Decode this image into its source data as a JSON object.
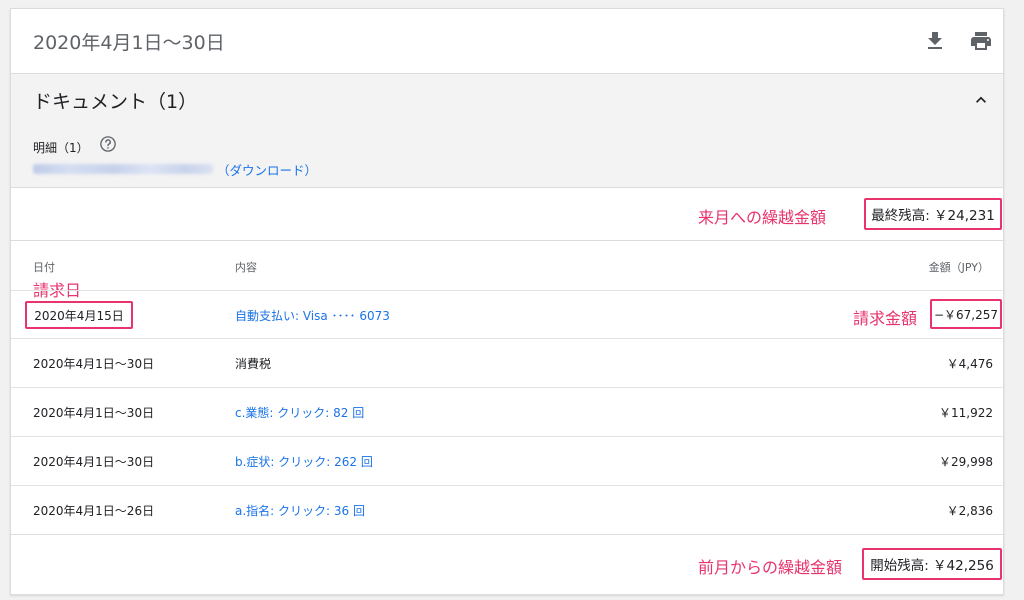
{
  "header": {
    "period": "2020年4月1日〜30日",
    "download_icon": "download-icon",
    "print_icon": "print-icon"
  },
  "documents": {
    "title": "ドキュメント（1）",
    "statement_label": "明細（1）",
    "help_icon": "help-circle-icon",
    "download_link": "（ダウンロード）"
  },
  "balance": {
    "final_annotation": "来月への繰越金額",
    "final_label": "最終残高: ￥24,231",
    "start_annotation": "前月からの繰越金額",
    "start_label": "開始残高: ￥42,256"
  },
  "table": {
    "columns": [
      "日付",
      "内容",
      "金額（JPY）"
    ],
    "billing_date_annotation": "請求日",
    "billing_amount_annotation": "請求金額",
    "rows": [
      {
        "date": "2020年4月15日",
        "desc": "自動支払い: Visa ････ 6073",
        "amount": "−￥67,257",
        "link": true
      },
      {
        "date": "2020年4月1日〜30日",
        "desc": "消費税",
        "amount": "￥4,476",
        "link": false
      },
      {
        "date": "2020年4月1日〜30日",
        "desc": "c.業態: クリック: 82 回",
        "amount": "￥11,922",
        "link": true
      },
      {
        "date": "2020年4月1日〜30日",
        "desc": "b.症状: クリック: 262 回",
        "amount": "￥29,998",
        "link": true
      },
      {
        "date": "2020年4月1日〜26日",
        "desc": "a.指名: クリック: 36 回",
        "amount": "￥2,836",
        "link": true
      }
    ]
  },
  "colors": {
    "accent_link": "#1a73e8",
    "annotation": "#e8336d"
  }
}
